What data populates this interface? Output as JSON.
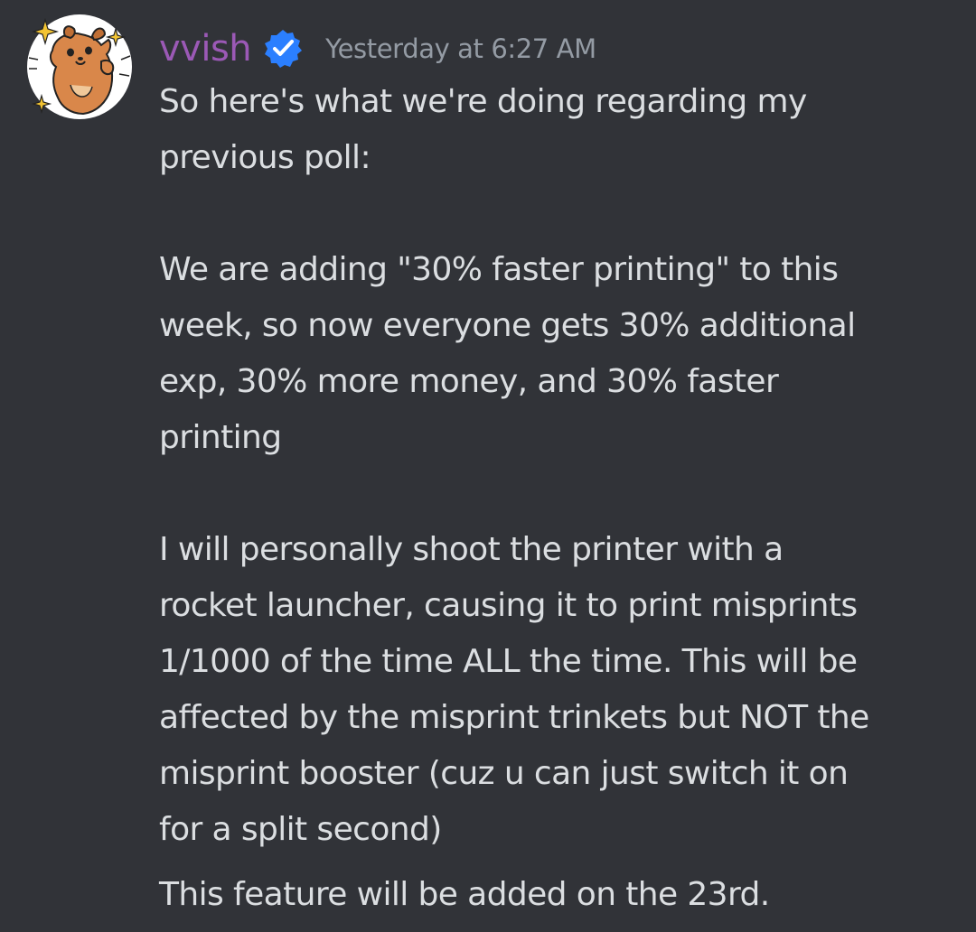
{
  "message": {
    "author": {
      "username": "vvish",
      "username_color": "#9b59b6",
      "verified_badge_color": "#2b7fff",
      "avatar_icon": "cartoon-dog-avatar-icon",
      "verified_icon": "verified-check-icon"
    },
    "timestamp": "Yesterday at 6:27 AM",
    "paragraphs": [
      "So here's what we're doing regarding my\nprevious poll:",
      "We are adding \"30% faster printing\" to this\nweek, so now everyone gets 30% additional\nexp, 30% more money, and 30% faster\nprinting",
      "I will personally shoot the printer with a\nrocket launcher, causing it to print misprints\n1/1000 of the time ALL the time. This will be\naffected by the misprint trinkets but NOT the\nmisprint booster (cuz u can just switch it on\nfor a split second)"
    ],
    "follow_up": "This feature will be added on the 23rd."
  },
  "theme": {
    "background": "#313338",
    "text": "#dbdee1",
    "muted": "#949ba4"
  }
}
